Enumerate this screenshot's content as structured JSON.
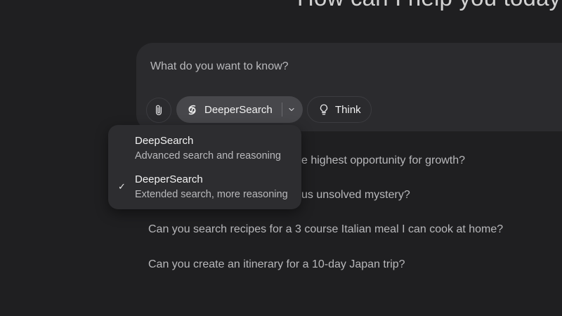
{
  "hero": {
    "title": "How can I help you today?"
  },
  "composer": {
    "placeholder": "What do you want to know?",
    "attach_icon": "paperclip-icon",
    "mode": {
      "icon": "deepersearch-swirl-icon",
      "label": "DeeperSearch",
      "chevron_icon": "chevron-down-icon"
    },
    "think": {
      "icon": "lightbulb-icon",
      "label": "Think"
    }
  },
  "dropdown": {
    "items": [
      {
        "title": "DeepSearch",
        "description": "Advanced search and reasoning",
        "selected": false
      },
      {
        "title": "DeeperSearch",
        "description": "Extended search, more reasoning",
        "selected": true,
        "check": "✓"
      }
    ]
  },
  "suggestions": [
    "e highest opportunity for growth?",
    "us unsolved mystery?",
    "Can you search recipes for a 3 course Italian meal I can cook at home?",
    "Can you create an itinerary for a 10-day Japan trip?"
  ],
  "colors": {
    "background": "#1f1f21",
    "composer": "#2b2b2e",
    "mode_button": "#47474b",
    "dropdown": "#2d2d30",
    "text_primary": "#f2f2f2",
    "text_secondary": "#b9b9bc"
  }
}
